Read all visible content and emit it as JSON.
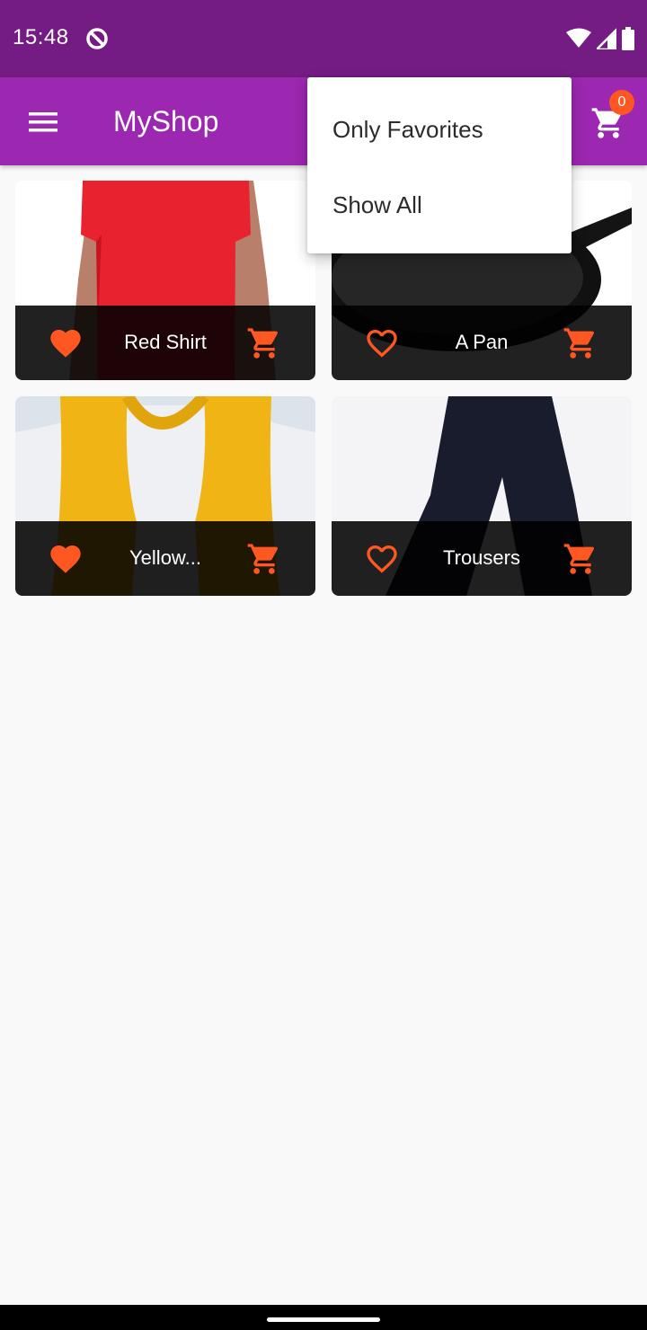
{
  "status_bar": {
    "time": "15:48"
  },
  "app_bar": {
    "title": "MyShop",
    "cart_count": "0"
  },
  "popup_menu": {
    "items": [
      "Only Favorites",
      "Show All"
    ]
  },
  "products": [
    {
      "title": "Red Shirt",
      "favorite": true
    },
    {
      "title": "A Pan",
      "favorite": false
    },
    {
      "title": "Yellow...",
      "favorite": true
    },
    {
      "title": "Trousers",
      "favorite": false
    }
  ],
  "colors": {
    "status_bar": "#741c84",
    "app_bar": "#9c27b0",
    "accent": "#ff5722",
    "card_footer": "#000000"
  },
  "icons": [
    "ring-icon",
    "wifi-icon",
    "signal-icon",
    "battery-icon",
    "menu-icon",
    "cart-icon",
    "heart-icon",
    "heart-outline-icon",
    "add-cart-icon"
  ]
}
